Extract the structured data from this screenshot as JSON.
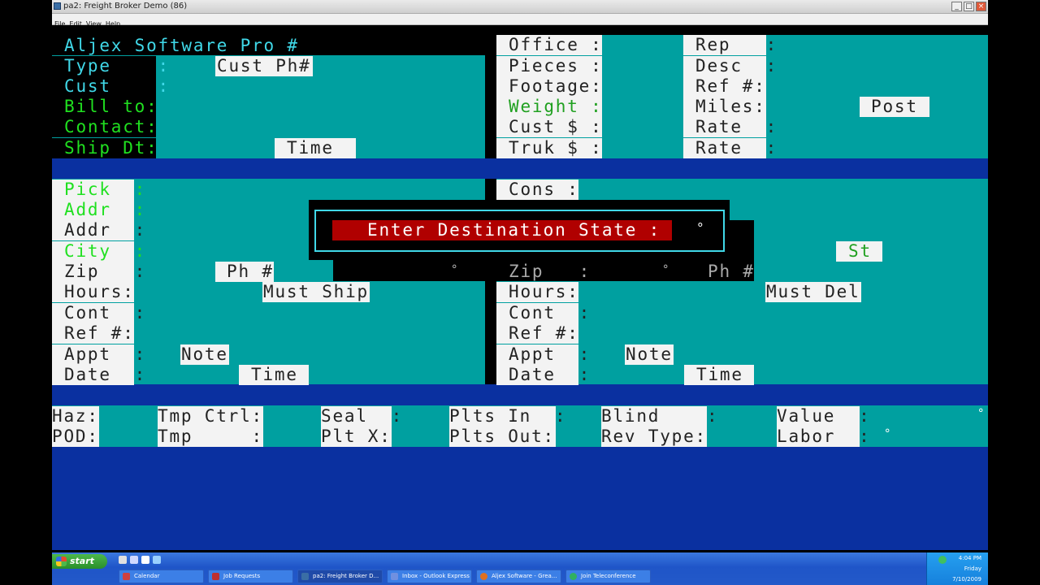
{
  "window": {
    "title": "pa2: Freight Broker Demo (86)",
    "menus": [
      "File",
      "Edit",
      "View",
      "Help"
    ],
    "controls": {
      "minimize": "_",
      "maximize": "□",
      "close": "×"
    }
  },
  "header": {
    "title": "Aljex Software Pro #"
  },
  "top_left": {
    "type_label": "Type    :",
    "cust_ph_button": "Cust Ph#",
    "cust_label": "Cust    :",
    "bill_to_label": "Bill to:",
    "contact_label": "Contact:",
    "ship_dt_label": "Ship Dt:",
    "time_button": "Time"
  },
  "top_right": {
    "office_label": "Office :",
    "pieces_label": "Pieces :",
    "footage_label": "Footage:",
    "weight_label": "Weight :",
    "cust_dollar_label": "Cust $ :",
    "truk_dollar_label": "Truk $ :",
    "rep_label": "Rep   :",
    "desc_label": "Desc  :",
    "ref_label": "Ref #:",
    "miles_label": "Miles:",
    "rate1_label": "Rate  :",
    "rate2_label": "Rate  :",
    "post_button": "Post"
  },
  "pick": {
    "pick_label": "Pick  :",
    "addr1_label": "Addr  :",
    "addr2_label": "Addr  :",
    "city_label": "City  :",
    "zip_label": "Zip   :",
    "ph_button": "Ph #",
    "hours_label": "Hours:",
    "must_ship_button": "Must Ship",
    "cont_label": "Cont  :",
    "ref_label": "Ref #:",
    "appt_label": "Appt  :",
    "note_button": "Note",
    "date_label": "Date  :",
    "time_button": "Time"
  },
  "cons": {
    "cons_label": "Cons :",
    "st_button": "St",
    "zip_label": "Zip   :",
    "ph_label": "Ph #",
    "hours_label": "Hours:",
    "must_del_button": "Must Del",
    "cont_label": "Cont  :",
    "ref_label": "Ref #:",
    "appt_label": "Appt  :",
    "note_button": "Note",
    "date_label": "Date  :",
    "time_button": "Time"
  },
  "bottom": {
    "haz_label": "Haz:",
    "pod_label": "POD:",
    "tmp_ctrl_label": "Tmp Ctrl:",
    "tmp_label": "Tmp     :",
    "seal_label": "Seal  :",
    "plt_x_label": "Plt X:",
    "plts_in_label": "Plts In  :",
    "plts_out_label": "Plts Out:",
    "blind_label": "Blind    :",
    "rev_type_label": "Rev Type:",
    "value_label": "Value  :",
    "labor_label": "Labor  :"
  },
  "dialog": {
    "prompt": "Enter Destination State :"
  },
  "markers": {
    "degree": "°"
  },
  "taskbar": {
    "start_label": "start",
    "buttons": [
      "Calendar",
      "Job Requests",
      "pa2: Freight Broker D...",
      "Inbox - Outlook Express",
      "Aljex Software - Grea...",
      "Join Teleconference"
    ],
    "clock_time": "4:04 PM",
    "clock_day": "Friday",
    "clock_date": "7/10/2009"
  },
  "colors": {
    "teal": "#00a0a0",
    "blue": "#0a30a0",
    "dialog_red": "#b00000",
    "label_green": "#20e020",
    "header_cyan": "#40d8e8"
  }
}
